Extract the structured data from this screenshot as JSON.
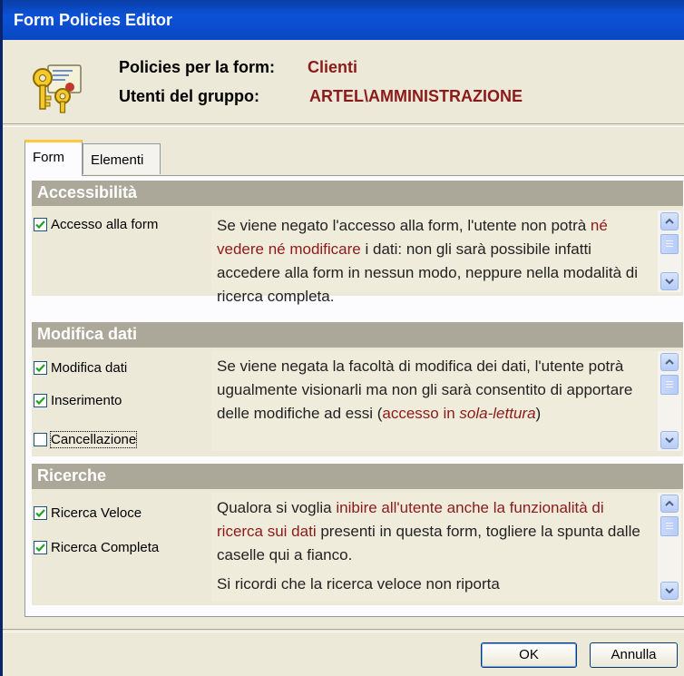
{
  "window": {
    "title": "Form Policies Editor"
  },
  "header": {
    "icon": "keys-certificate-icon",
    "policies_label": "Policies per la form:",
    "form_name": "Clienti",
    "users_label": "Utenti del gruppo:",
    "group_name": "ARTEL\\AMMINISTRAZIONE"
  },
  "tabs": [
    {
      "label": "Form",
      "active": true
    },
    {
      "label": "Elementi",
      "active": false
    }
  ],
  "sections": {
    "accessibilita": {
      "title": "Accessibilità",
      "checkboxes": [
        {
          "label": "Accesso alla form",
          "checked": true
        }
      ],
      "description": {
        "p1_a": "Se viene negato l'accesso alla form, l'utente non potrà ",
        "p1_hl": "né vedere né modificare",
        "p1_b": " i dati: non gli sarà possibile infatti accedere alla form in nessun modo, neppure nella modalità di ricerca completa."
      }
    },
    "modifica": {
      "title": "Modifica dati",
      "checkboxes": [
        {
          "label": "Modifica dati",
          "checked": true
        },
        {
          "label": "Inserimento",
          "checked": true
        },
        {
          "label": "Cancellazione",
          "checked": false
        }
      ],
      "description": {
        "p1_a": "Se viene negata la facoltà di modifica dei dati, l'utente potrà ugualmente visionarli ma non gli sarà consentito di apportare delle modifiche ad essi (",
        "p1_hl": "accesso in ",
        "p1_hl_italic": "sola-lettura",
        "p1_b": ")"
      }
    },
    "ricerche": {
      "title": "Ricerche",
      "checkboxes": [
        {
          "label": "Ricerca Veloce",
          "checked": true
        },
        {
          "label": "Ricerca Completa",
          "checked": true
        }
      ],
      "description": {
        "p1_a": "Qualora si voglia ",
        "p1_hl": "inibire all'utente anche la funzionalità di ricerca sui dati",
        "p1_b": " presenti in questa form, togliere la spunta dalle caselle qui a fianco.",
        "p2": "Si ricordi che la ricerca veloce non riporta"
      }
    }
  },
  "buttons": {
    "ok": "OK",
    "cancel": "Annulla"
  },
  "colors": {
    "title_bar": "#0b52d8",
    "highlight": "#8b1a1a",
    "section_header": "#aca899",
    "tab_accent": "#ffc83c"
  }
}
